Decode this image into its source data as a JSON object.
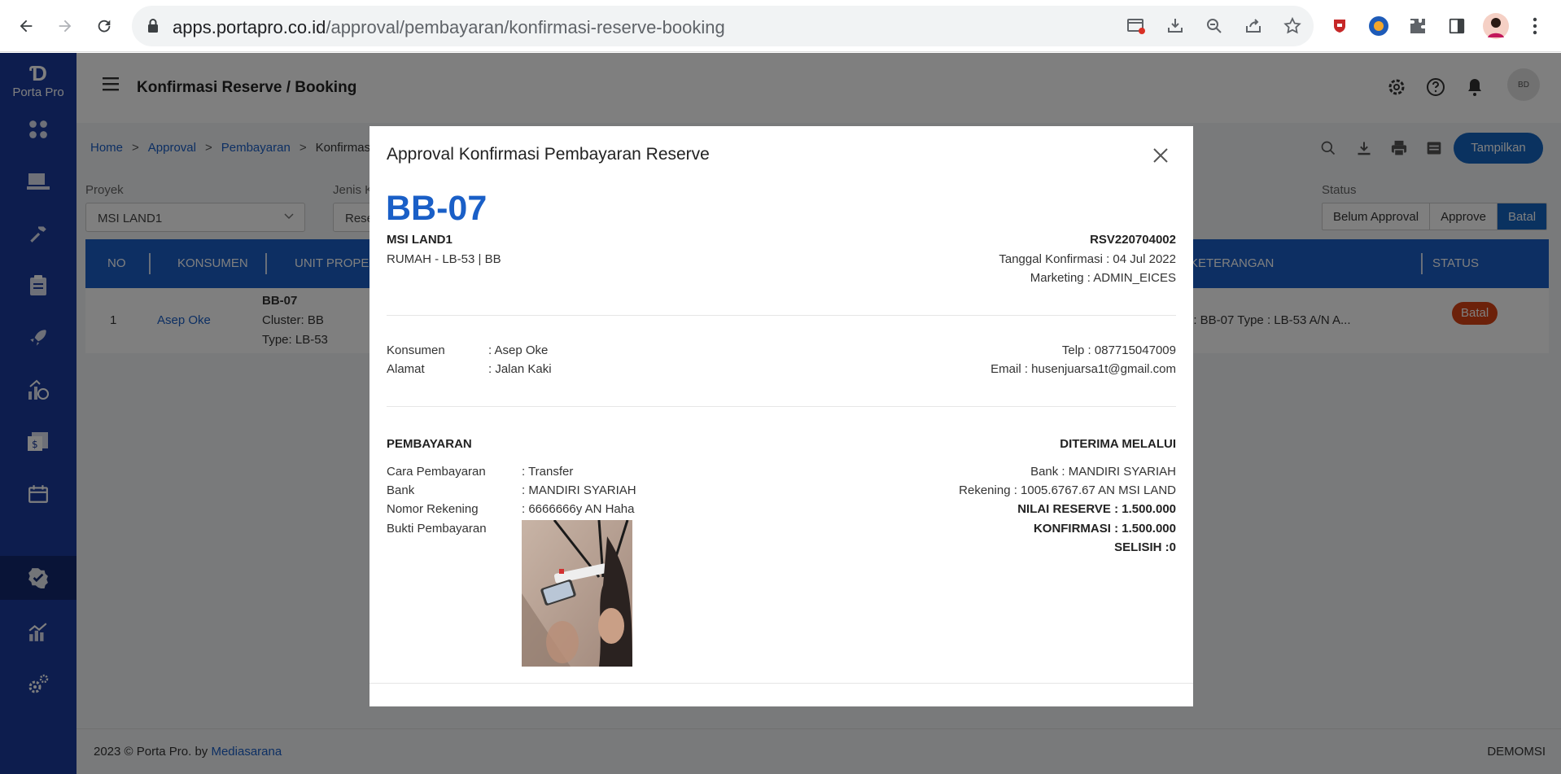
{
  "browser": {
    "url_domain": "apps.portapro.co.id",
    "url_path": "/approval/pembayaran/konfirmasi-reserve-booking"
  },
  "app": {
    "logo_text": "Porta Pro",
    "page_title": "Konfirmasi Reserve / Booking",
    "avatar_text": "BD"
  },
  "breadcrumb": {
    "items": [
      "Home",
      "Approval",
      "Pembayaran"
    ],
    "current": "Konfirmas",
    "separator": ">"
  },
  "toolbar": {
    "show_label": "Tampilkan"
  },
  "filters": {
    "project_label": "Proyek",
    "project_value": "MSI LAND1",
    "type_label": "Jenis K",
    "type_value": "Rese",
    "status_label": "Status",
    "status_options": [
      "Belum Approval",
      "Approve",
      "Batal"
    ],
    "status_selected": "Batal"
  },
  "table": {
    "headers": {
      "no": "NO",
      "konsumen": "KONSUMEN",
      "unit": "UNIT PROPE",
      "keterangan": "KETERANGAN",
      "status": "STATUS"
    },
    "row": {
      "no": "1",
      "konsumen": "Asep Oke",
      "unit_code": "BB-07",
      "cluster": "Cluster: BB",
      "type": "Type: LB-53",
      "keterangan": ": : BB-07 Type : LB-53 A/N A...",
      "status": "Batal"
    }
  },
  "footer": {
    "copyright": "2023 © Porta Pro. by ",
    "company": "Mediasarana",
    "tenant": "DEMOMSI"
  },
  "modal": {
    "title": "Approval Konfirmasi Pembayaran Reserve",
    "unit_code": "BB-07",
    "project": "MSI LAND1",
    "unit_detail": "RUMAH - LB-53 | BB",
    "reserve_no": "RSV220704002",
    "confirm_date": "Tanggal Konfirmasi : 04 Jul 2022",
    "marketing": "Marketing : ADMIN_EICES",
    "customer": {
      "name_label": "Konsumen",
      "name_value": ": Asep Oke",
      "address_label": "Alamat",
      "address_value": ": Jalan Kaki",
      "phone": "Telp : 087715047009",
      "email": "Email : husenjuarsa1t@gmail.com"
    },
    "payment": {
      "heading": "PEMBAYARAN",
      "method_label": "Cara Pembayaran",
      "method_value": ": Transfer",
      "bank_label": "Bank",
      "bank_value": ": MANDIRI SYARIAH",
      "account_label": "Nomor Rekening",
      "account_value": ": 6666666y AN Haha",
      "proof_label": "Bukti Pembayaran"
    },
    "received": {
      "heading": "DITERIMA MELALUI",
      "bank": "Bank : MANDIRI SYARIAH",
      "account": "Rekening : 1005.6767.67 AN MSI LAND",
      "reserve_value": "NILAI RESERVE : 1.500.000",
      "confirmation": "KONFIRMASI : 1.500.000",
      "difference": "SELISIH :0"
    }
  },
  "icons": {
    "sidebar": [
      "dashboard-icon",
      "project-icon",
      "hammer-icon",
      "clipboard-icon",
      "rocket-icon",
      "money-chart-icon",
      "invoice-icon",
      "calendar-icon",
      "check-badge-icon",
      "bar-chart-icon",
      "gears-icon"
    ],
    "accent_color": "#1a5fc7",
    "sidebar_color": "#1a3a9c"
  }
}
